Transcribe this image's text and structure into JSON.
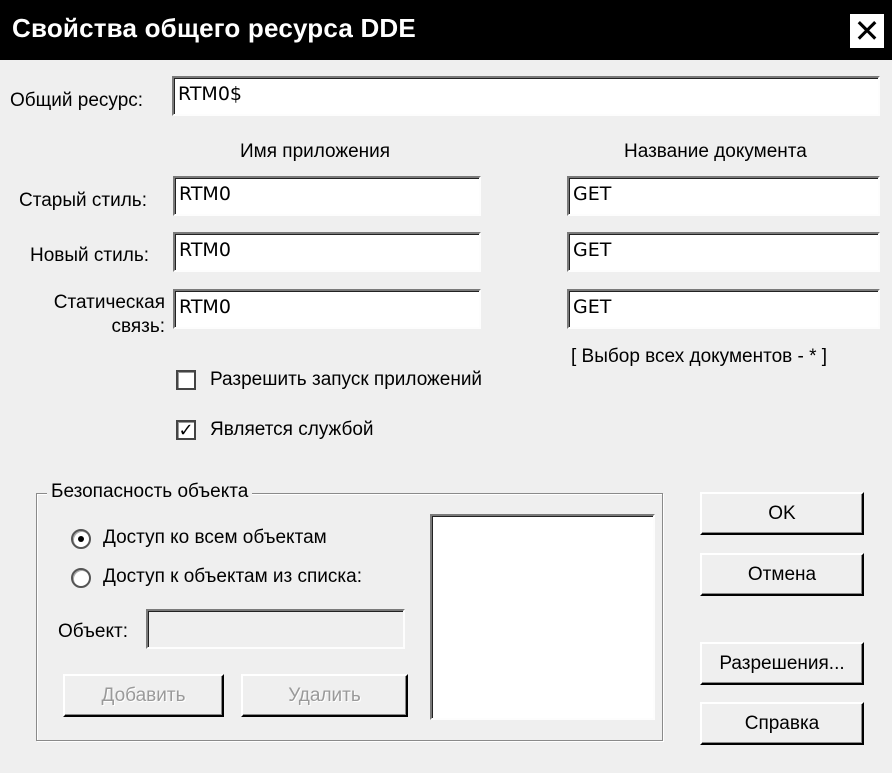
{
  "dialog": {
    "title": "Свойства общего ресурса DDE",
    "close_glyph": "✕"
  },
  "share": {
    "label": "Общий ресурс:",
    "value": "RTM0$"
  },
  "headers": {
    "app_name": "Имя приложения",
    "doc_name": "Название документа"
  },
  "rows": [
    {
      "label": "Старый стиль:",
      "app": "RTM0",
      "doc": "GET"
    },
    {
      "label": "Новый стиль:",
      "app": "RTM0",
      "doc": "GET"
    },
    {
      "label_line1": "Статическая",
      "label_line2": "связь:",
      "app": "RTM0",
      "doc": "GET"
    }
  ],
  "hint": "[ Выбор всех документов - * ]",
  "checkboxes": {
    "allow_launch": {
      "label": "Разрешить запуск приложений",
      "checked": false
    },
    "is_service": {
      "label": "Является службой",
      "checked": true
    }
  },
  "security": {
    "group_title": "Безопасность объекта",
    "radio_all": "Доступ ко всем объектам",
    "radio_list": "Доступ к объектам из списка:",
    "selected": "all",
    "object_label": "Объект:",
    "object_value": "",
    "add_button": "Добавить",
    "remove_button": "Удалить"
  },
  "buttons": {
    "ok": "OK",
    "cancel": "Отмена",
    "permissions": "Разрешения...",
    "help": "Справка"
  },
  "colors": {
    "title_bg": "#000000",
    "dialog_bg": "#efefef"
  }
}
